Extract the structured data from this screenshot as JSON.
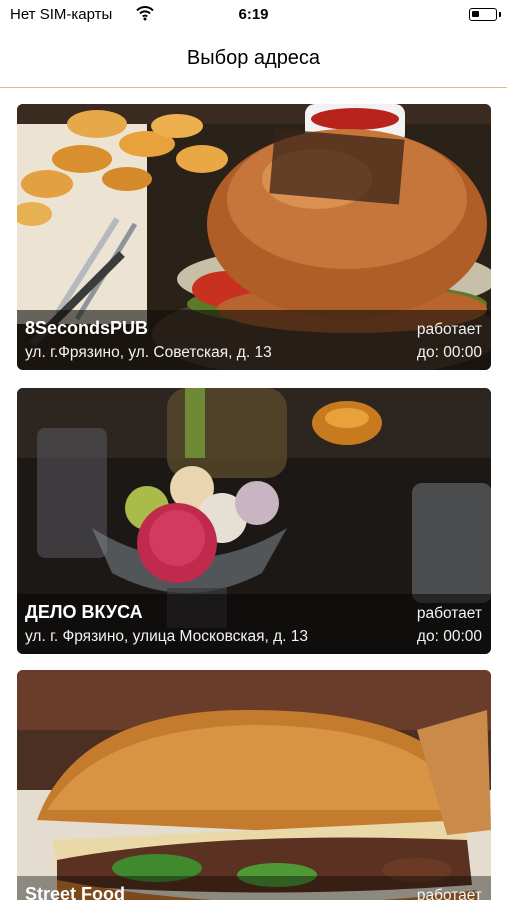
{
  "status_bar": {
    "carrier": "Нет SIM-карты",
    "time": "6:19",
    "battery_level": 0.35
  },
  "nav": {
    "title": "Выбор адреса"
  },
  "places": [
    {
      "name": "8SecondsPUB",
      "address": "ул. г.Фрязино, ул. Советская, д. 13",
      "status": "работает",
      "hours": "до: 00:00",
      "image": "burger-with-fries-photo"
    },
    {
      "name": "ДЕЛО ВКУСА",
      "address": "ул. г. Фрязино, улица Московская, д. 13",
      "status": "работает",
      "hours": "до: 00:00",
      "image": "macarons-and-drinks-photo"
    },
    {
      "name": "Street Food",
      "address": "",
      "status": "работает",
      "hours": "",
      "image": "sandwich-photo"
    }
  ]
}
